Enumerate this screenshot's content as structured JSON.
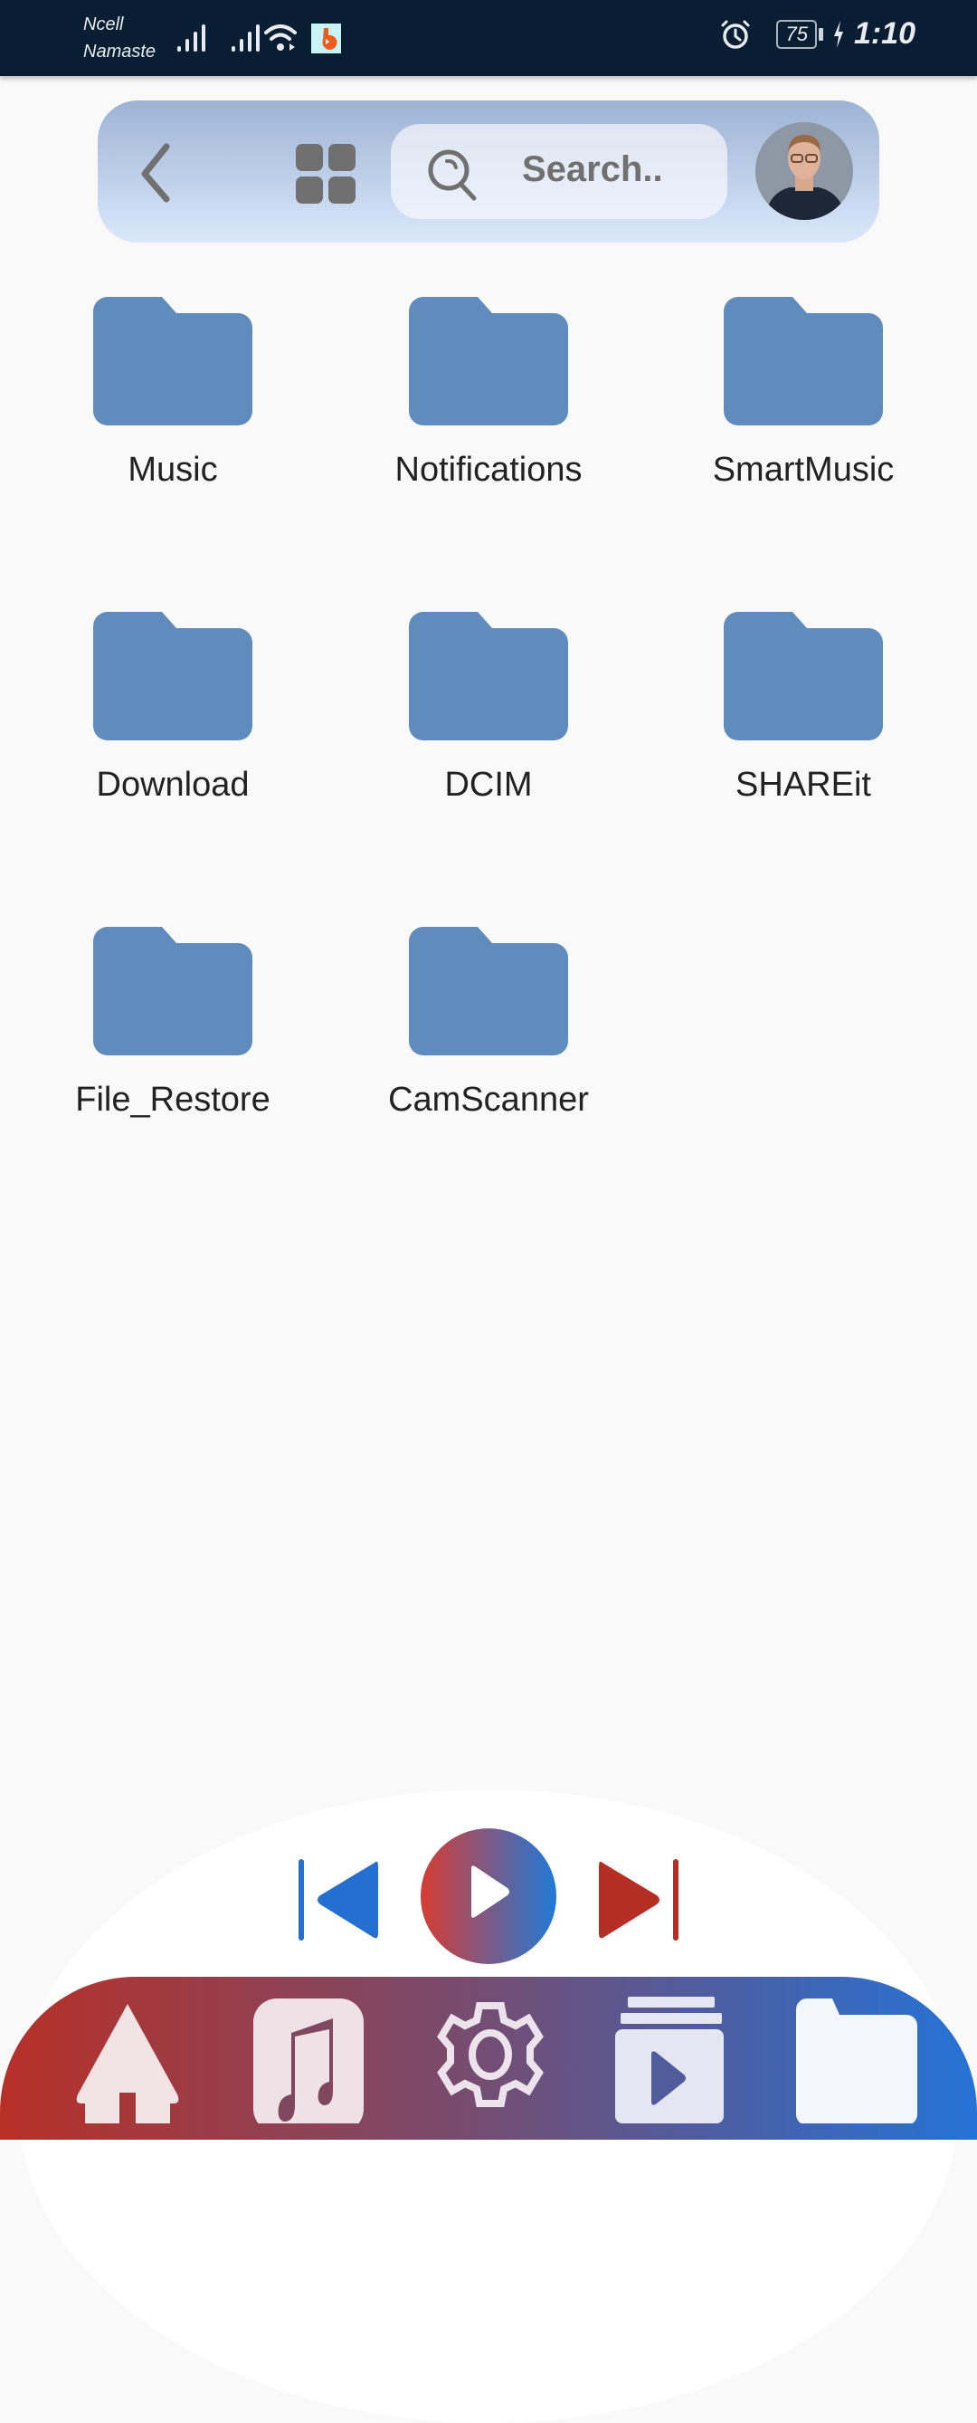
{
  "status_bar": {
    "carrier_line1": "Ncell",
    "carrier_line2": "Namaste",
    "battery": "75",
    "time": "1:10",
    "icons": [
      "signal-icon",
      "signal-icon",
      "wifi-icon",
      "app-notification-icon",
      "alarm-icon",
      "battery-icon",
      "charging-icon"
    ]
  },
  "top_bar": {
    "back_icon": "chevron-left-icon",
    "view_toggle_icon": "grid-view-icon",
    "search": {
      "placeholder": "Search.."
    },
    "avatar_icon": "user-avatar"
  },
  "folders": [
    {
      "name": "Music"
    },
    {
      "name": "Notifications"
    },
    {
      "name": "SmartMusic"
    },
    {
      "name": "Download"
    },
    {
      "name": "DCIM"
    },
    {
      "name": "SHAREit"
    },
    {
      "name": "File_Restore"
    },
    {
      "name": "CamScanner"
    }
  ],
  "player": {
    "controls": [
      "skip-previous-icon",
      "play-icon",
      "skip-next-icon"
    ],
    "colors": {
      "prev": "#2470d2",
      "next": "#b52e25",
      "play_from": "#d63c32",
      "play_to": "#1f7ad8"
    }
  },
  "bottom_nav": {
    "items": [
      {
        "id": "home",
        "icon": "home-icon"
      },
      {
        "id": "music",
        "icon": "music-note-icon"
      },
      {
        "id": "settings",
        "icon": "gear-icon"
      },
      {
        "id": "videos",
        "icon": "video-library-icon"
      },
      {
        "id": "files",
        "icon": "folder-icon"
      }
    ]
  },
  "colors": {
    "folder": "#608bbd",
    "statusbar": "#0a1e33",
    "background": "#f9f9f9"
  }
}
